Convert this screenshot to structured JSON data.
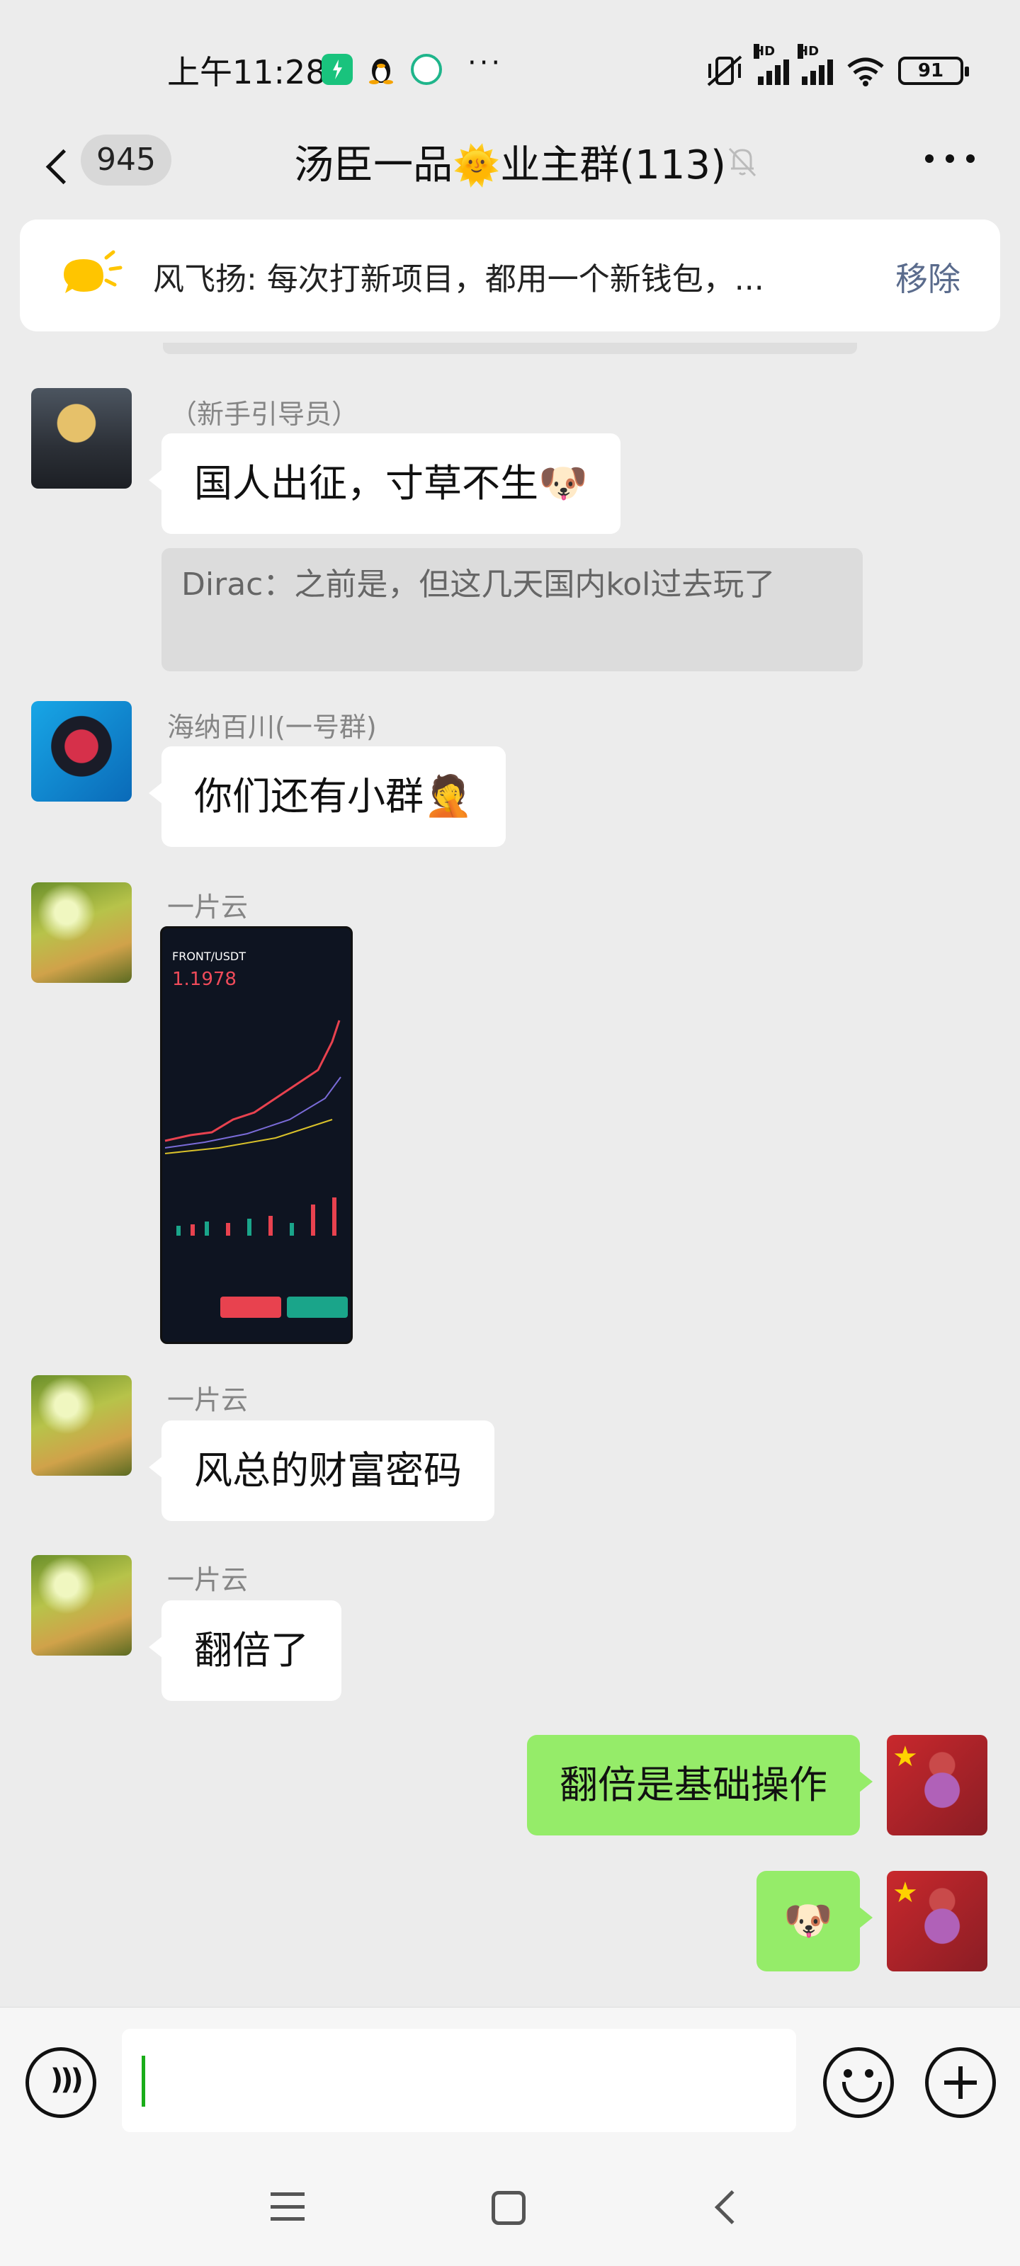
{
  "status_bar": {
    "time": "上午11:28",
    "dots": "···",
    "hd1": "HD",
    "hd2": "HD",
    "battery": "91"
  },
  "header": {
    "unread_count": "945",
    "title_pre": "汤臣一品",
    "title_emoji": "🌞",
    "title_post": "业主群(113)"
  },
  "pinned": {
    "text": "风飞扬: 每次打新项目，都用一个新钱包，...",
    "remove_label": "移除"
  },
  "messages": [
    {
      "sender": "（新手引导员）",
      "text": "国人出征，寸草不生",
      "emoji": "🐶",
      "quote": "Dirac：之前是，但这几天国内kol过去玩了"
    },
    {
      "sender": "海纳百川(一号群)",
      "text": "你们还有小群",
      "emoji": "🤦"
    },
    {
      "sender": "一片云",
      "image_pair": "FRONT/USDT",
      "image_price": "1.1978"
    },
    {
      "sender": "一片云",
      "text": "风总的财富密码"
    },
    {
      "sender": "一片云",
      "text": "翻倍了"
    },
    {
      "sender": "me",
      "text": "翻倍是基础操作"
    },
    {
      "sender": "me",
      "emoji": "🐶"
    }
  ],
  "icons": {
    "voice": "voice-icon",
    "emoji": "emoji-icon",
    "plus": "plus-icon",
    "mute": "mute-icon",
    "more": "more-icon",
    "back": "back-icon"
  },
  "colors": {
    "bubble_self": "#95ec69",
    "bubble_other": "#ffffff",
    "background": "#ececec",
    "caret": "#1aad19"
  }
}
